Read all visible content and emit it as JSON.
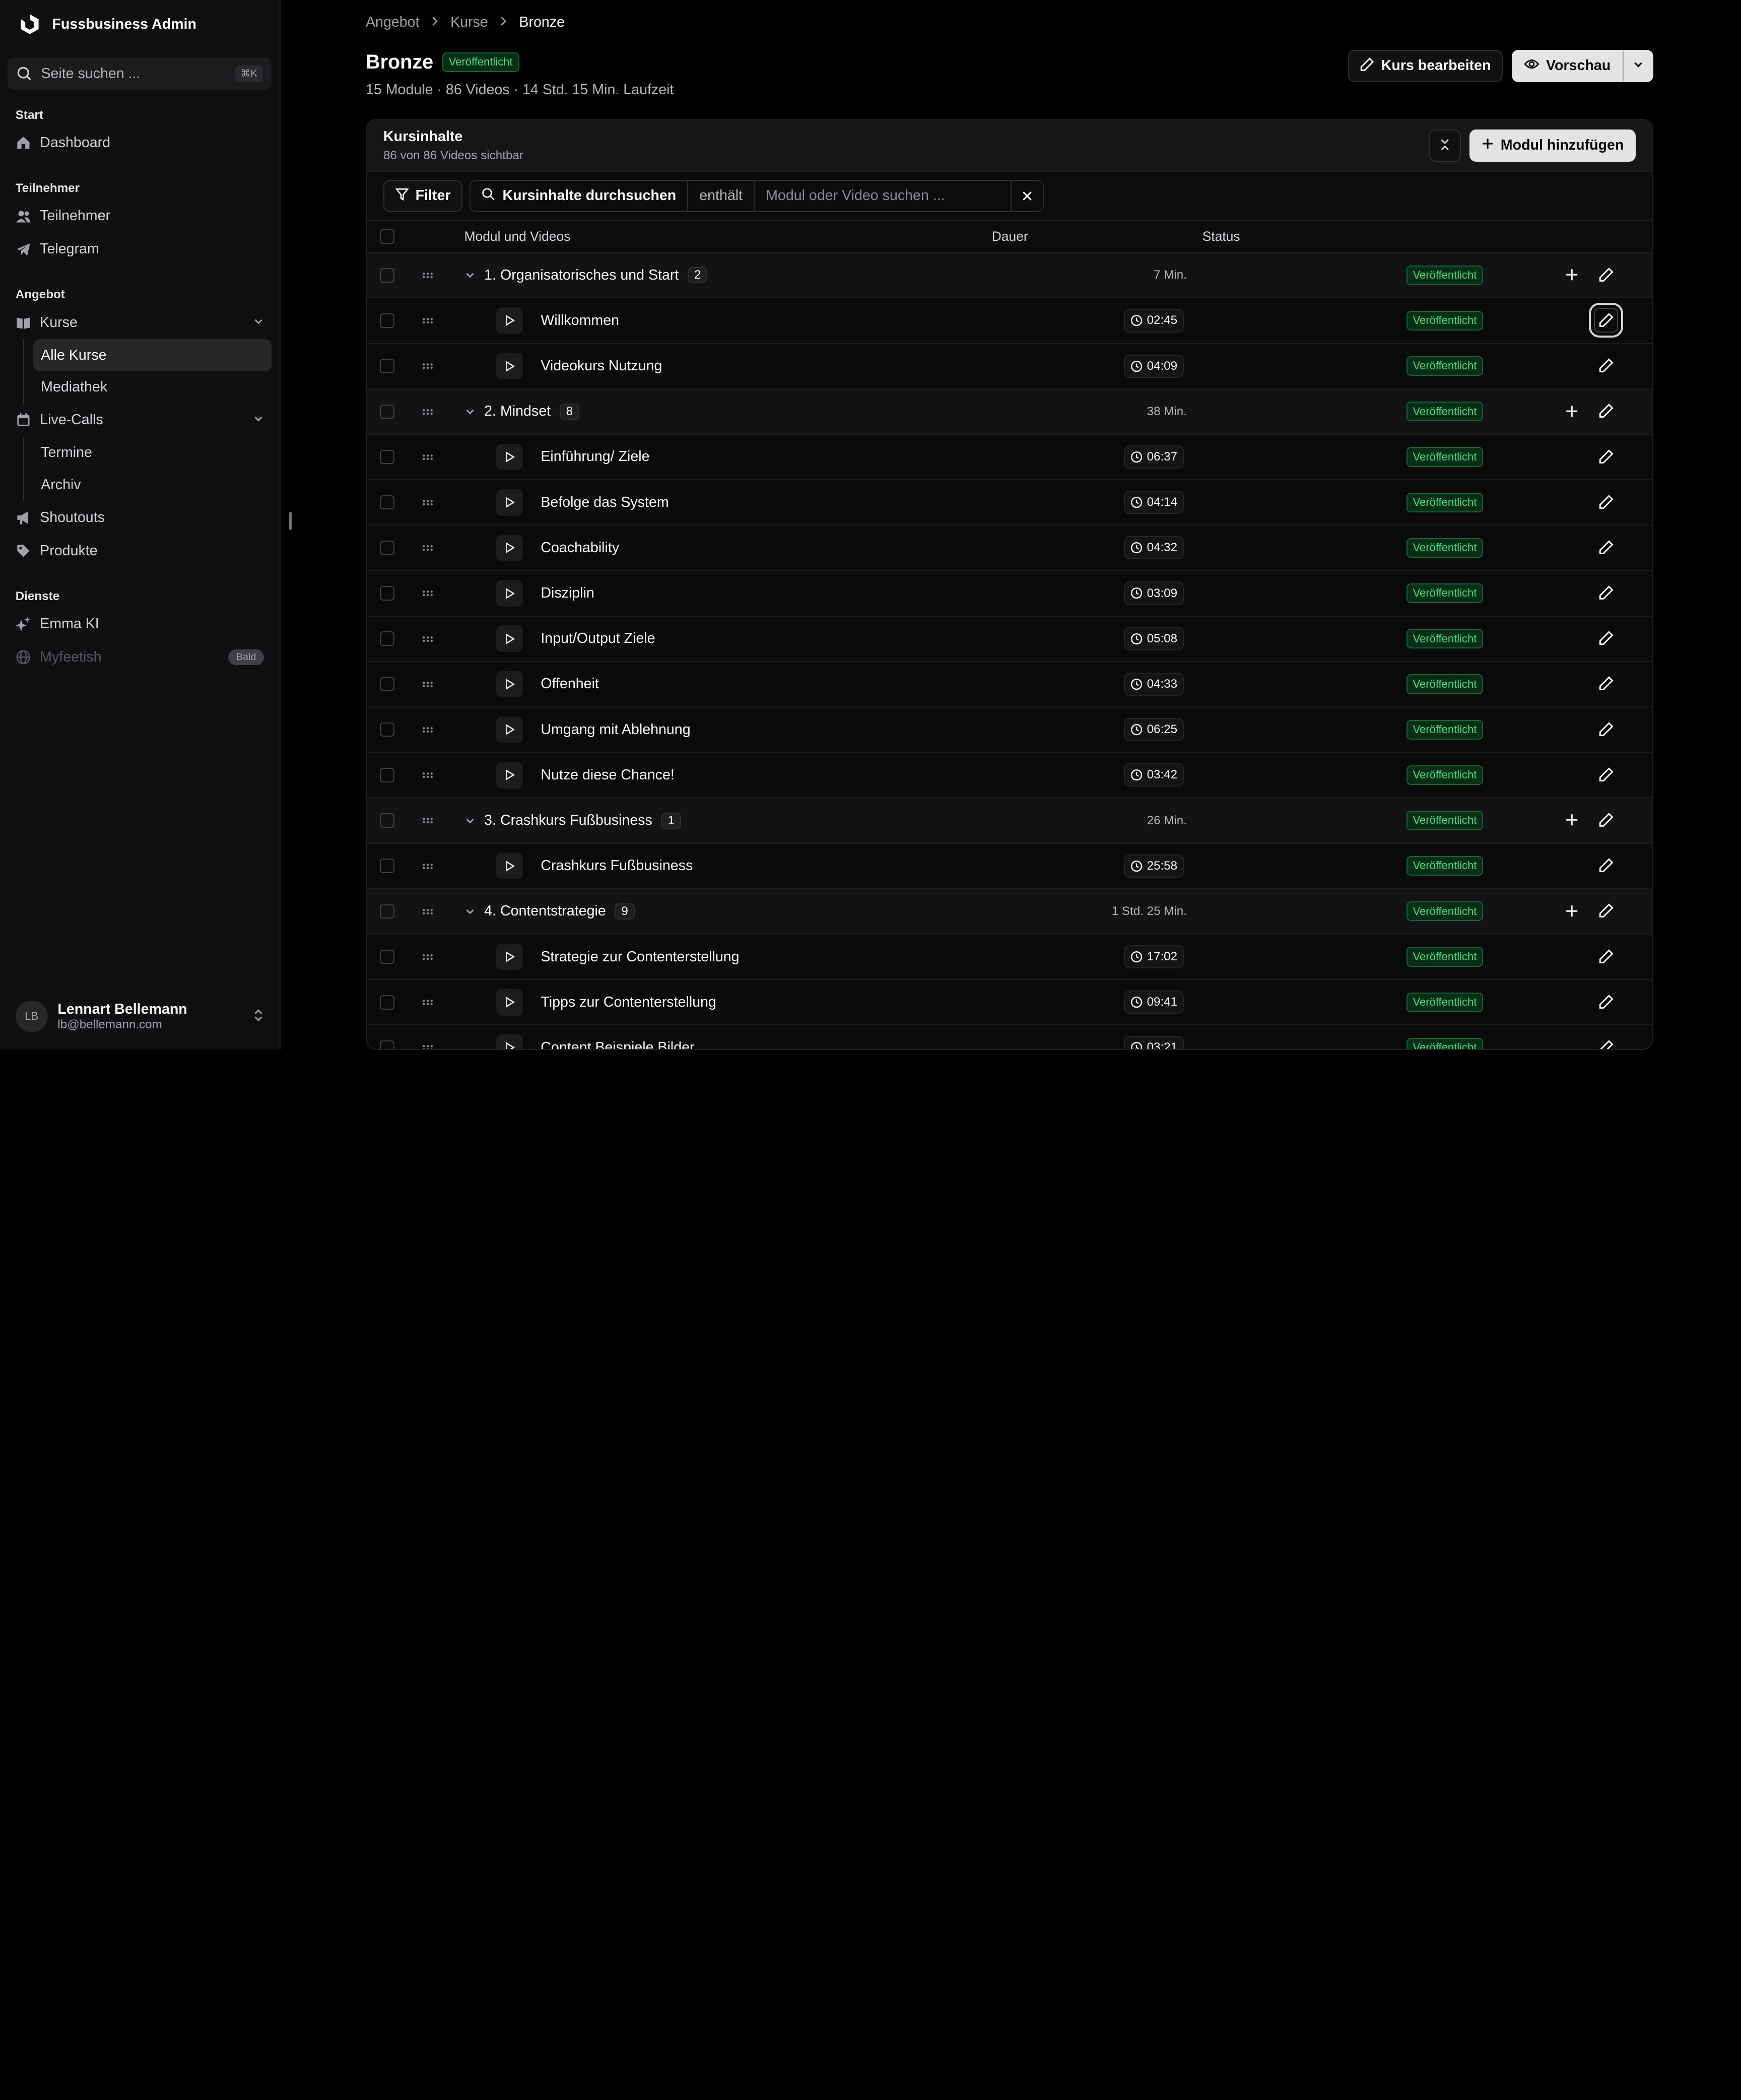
{
  "app": {
    "name": "Fussbusiness Admin"
  },
  "sidebar": {
    "search": {
      "placeholder": "Seite suchen ...",
      "shortcut": "⌘K"
    },
    "sections": [
      {
        "label": "Start"
      },
      {
        "label": "Teilnehmer"
      },
      {
        "label": "Angebot"
      },
      {
        "label": "Dienste"
      }
    ],
    "items": {
      "dashboard": "Dashboard",
      "teilnehmer": "Teilnehmer",
      "telegram": "Telegram",
      "kurse": "Kurse",
      "alle_kurse": "Alle Kurse",
      "mediathek": "Mediathek",
      "live_calls": "Live-Calls",
      "termine": "Termine",
      "archiv": "Archiv",
      "shoutouts": "Shoutouts",
      "produkte": "Produkte",
      "emma_ki": "Emma KI",
      "myfeetish": "Myfeetish",
      "myfeetish_badge": "Bald"
    },
    "user": {
      "initials": "LB",
      "name": "Lennart Bellemann",
      "email": "lb@bellemann.com"
    }
  },
  "breadcrumb": [
    "Angebot",
    "Kurse",
    "Bronze"
  ],
  "page": {
    "title": "Bronze",
    "status": "Veröffentlicht",
    "subtitle": "15 Module · 86 Videos · 14 Std. 15 Min. Laufzeit",
    "edit_label": "Kurs bearbeiten",
    "preview_label": "Vorschau"
  },
  "content": {
    "title": "Kursinhalte",
    "subtitle": "86 von 86 Videos sichtbar",
    "add_module_label": "Modul hinzufügen",
    "filter_label": "Filter",
    "search_field": "Kursinhalte durchsuchen",
    "search_operator": "enthält",
    "search_placeholder": "Modul oder Video suchen ...",
    "columns": {
      "name": "Modul und Videos",
      "duration": "Dauer",
      "status": "Status"
    },
    "rows": [
      {
        "type": "module",
        "name": "1. Organisatorisches und Start",
        "count": "2",
        "duration": "7 Min.",
        "status": "Veröffentlicht"
      },
      {
        "type": "video",
        "name": "Willkommen",
        "duration": "02:45",
        "status": "Veröffentlicht"
      },
      {
        "type": "video",
        "name": "Videokurs Nutzung",
        "duration": "04:09",
        "status": "Veröffentlicht"
      },
      {
        "type": "module",
        "name": "2. Mindset",
        "count": "8",
        "duration": "38 Min.",
        "status": "Veröffentlicht"
      },
      {
        "type": "video",
        "name": "Einführung/ Ziele",
        "duration": "06:37",
        "status": "Veröffentlicht"
      },
      {
        "type": "video",
        "name": "Befolge das System",
        "duration": "04:14",
        "status": "Veröffentlicht"
      },
      {
        "type": "video",
        "name": "Coachability",
        "duration": "04:32",
        "status": "Veröffentlicht"
      },
      {
        "type": "video",
        "name": "Disziplin",
        "duration": "03:09",
        "status": "Veröffentlicht"
      },
      {
        "type": "video",
        "name": "Input/Output Ziele",
        "duration": "05:08",
        "status": "Veröffentlicht"
      },
      {
        "type": "video",
        "name": "Offenheit",
        "duration": "04:33",
        "status": "Veröffentlicht"
      },
      {
        "type": "video",
        "name": "Umgang mit Ablehnung",
        "duration": "06:25",
        "status": "Veröffentlicht"
      },
      {
        "type": "video",
        "name": "Nutze diese Chance!",
        "duration": "03:42",
        "status": "Veröffentlicht"
      },
      {
        "type": "module",
        "name": "3. Crashkurs Fußbusiness",
        "count": "1",
        "duration": "26 Min.",
        "status": "Veröffentlicht"
      },
      {
        "type": "video",
        "name": "Crashkurs Fußbusiness",
        "duration": "25:58",
        "status": "Veröffentlicht"
      },
      {
        "type": "module",
        "name": "4. Contentstrategie",
        "count": "9",
        "duration": "1 Std. 25 Min.",
        "status": "Veröffentlicht"
      },
      {
        "type": "video",
        "name": "Strategie zur Contenterstellung",
        "duration": "17:02",
        "status": "Veröffentlicht"
      },
      {
        "type": "video",
        "name": "Tipps zur Contenterstellung",
        "duration": "09:41",
        "status": "Veröffentlicht"
      },
      {
        "type": "video",
        "name": "Content Beispiele Bilder",
        "duration": "03:21",
        "status": "Veröffentlicht"
      }
    ]
  },
  "colors": {
    "background": "#000000",
    "sidebar": "#0f0f11",
    "status_green": "#4ade80",
    "status_green_bg": "#052e16"
  }
}
